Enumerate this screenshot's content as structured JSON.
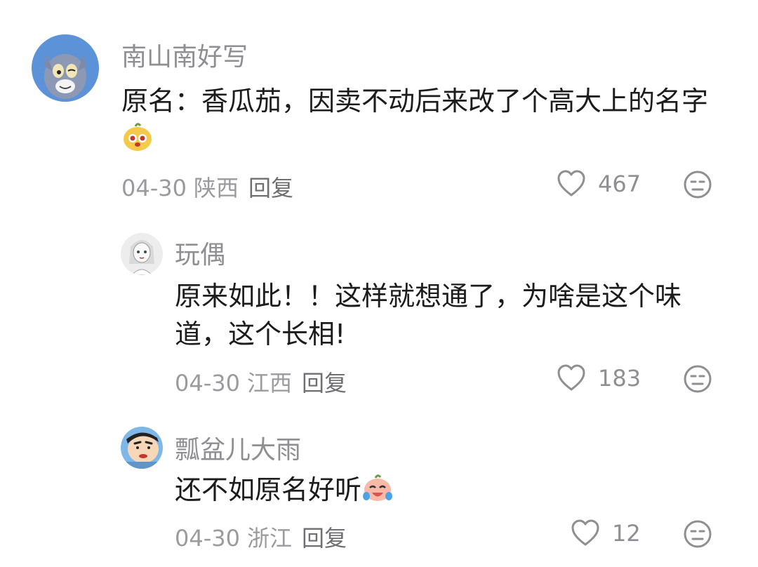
{
  "comments": [
    {
      "username": "南山南好写",
      "content": "原名：香瓜茄，因卖不动后来改了个高大上的名字",
      "date": "04-30",
      "location": "陕西",
      "reply_label": "回复",
      "likes": "467"
    },
    {
      "username": "玩偶",
      "content": "原来如此！！这样就想通了，为啥是这个味道，这个长相!",
      "date": "04-30",
      "location": "江西",
      "reply_label": "回复",
      "likes": "183"
    },
    {
      "username": "瓢盆儿大雨",
      "content": "还不如原名好听",
      "date": "04-30",
      "location": "浙江",
      "reply_label": "回复",
      "likes": "12"
    }
  ],
  "icons": {
    "like": "heart-outline-icon",
    "dislike": "neutral-face-icon",
    "emoji_1": "yellow-pear-emoji",
    "emoji_2": "crying-laughing-emoji"
  },
  "colors": {
    "username": "#8e8e93",
    "content": "#1c1c1e",
    "meta": "#9b9b9f"
  }
}
